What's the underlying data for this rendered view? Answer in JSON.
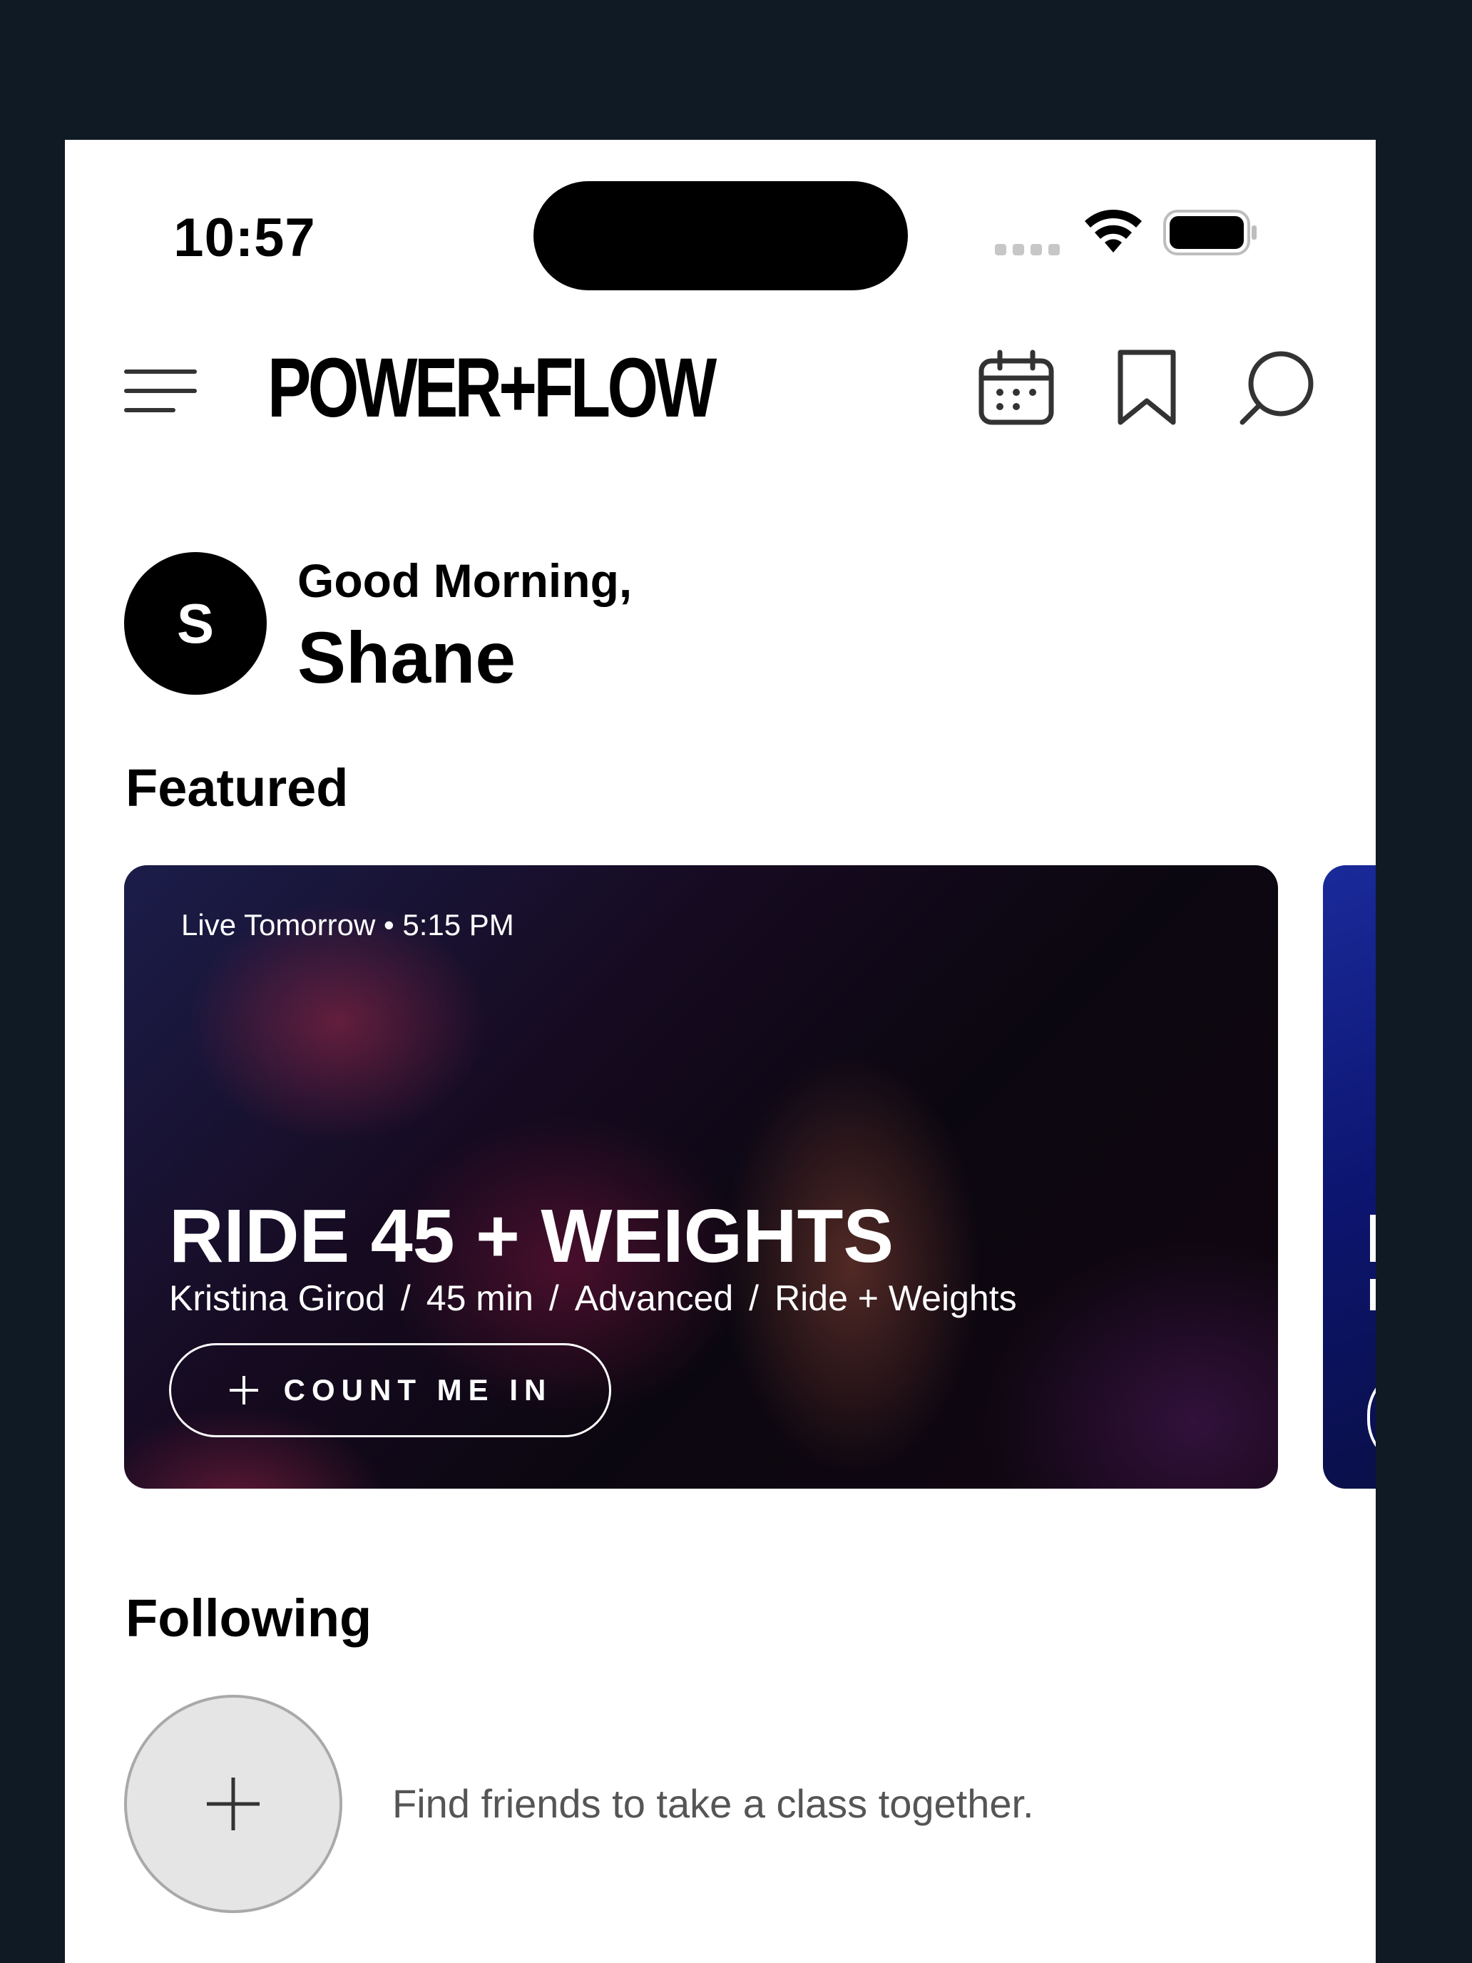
{
  "status_bar": {
    "time": "10:57"
  },
  "header": {
    "logo": "POWER+FLOW"
  },
  "greeting": {
    "avatar_initial": "S",
    "line": "Good Morning,",
    "name": "Shane"
  },
  "featured": {
    "title": "Featured",
    "card": {
      "live_label": "Live Tomorrow • 5:15 PM",
      "title": "RIDE 45 + WEIGHTS",
      "instructor": "Kristina Girod",
      "duration": "45 min",
      "level": "Advanced",
      "category": "Ride + Weights",
      "separator": "/",
      "button_label": "COUNT ME IN"
    }
  },
  "following": {
    "title": "Following",
    "prompt": "Find friends to take a class together."
  },
  "colors": {
    "page_background": "#0f1a24",
    "card_text": "#ffffff",
    "accent": "#000000"
  }
}
